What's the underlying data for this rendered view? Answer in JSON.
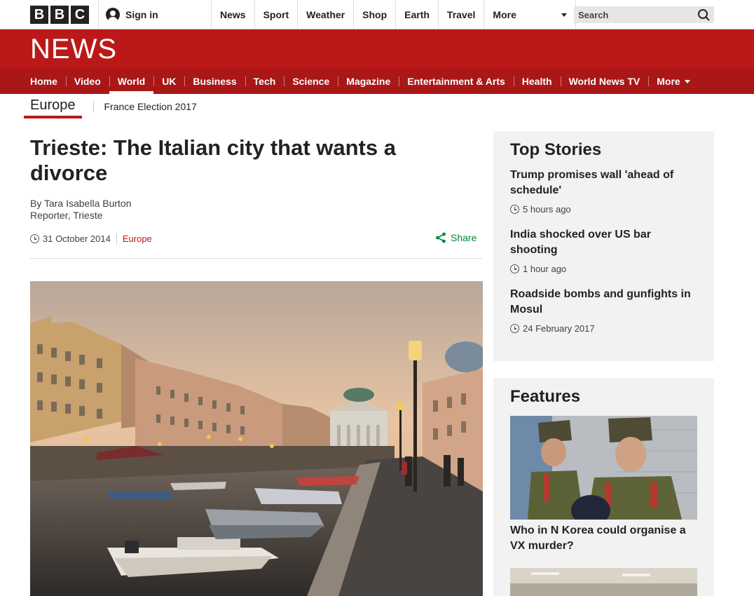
{
  "brand": {
    "letters": [
      "B",
      "B",
      "C"
    ]
  },
  "topbar": {
    "signin_label": "Sign in",
    "nav": [
      "News",
      "Sport",
      "Weather",
      "Shop",
      "Earth",
      "Travel"
    ],
    "more_label": "More",
    "search_placeholder": "Search"
  },
  "news_title": "NEWS",
  "mainnav": {
    "items": [
      "Home",
      "Video",
      "World",
      "UK",
      "Business",
      "Tech",
      "Science",
      "Magazine",
      "Entertainment & Arts",
      "Health",
      "World News TV"
    ],
    "active": "World",
    "more_label": "More"
  },
  "subnav": {
    "section": "Europe",
    "item": "France Election 2017"
  },
  "article": {
    "headline": "Trieste: The Italian city that wants a divorce",
    "author": "By Tara Isabella Burton",
    "role": "Reporter, Trieste",
    "date": "31 October 2014",
    "category": "Europe",
    "share_label": "Share"
  },
  "top_stories": {
    "title": "Top Stories",
    "items": [
      {
        "title": "Trump promises wall 'ahead of schedule'",
        "time": "5 hours ago"
      },
      {
        "title": "India shocked over US bar shooting",
        "time": "1 hour ago"
      },
      {
        "title": "Roadside bombs and gunfights in Mosul",
        "time": "24 February 2017"
      }
    ]
  },
  "features": {
    "title": "Features",
    "items": [
      {
        "title": "Who in N Korea could organise a VX murder?"
      }
    ]
  },
  "colors": {
    "brand_red": "#bb1919",
    "nav_red": "#a91717",
    "share_green": "#008a3a"
  }
}
